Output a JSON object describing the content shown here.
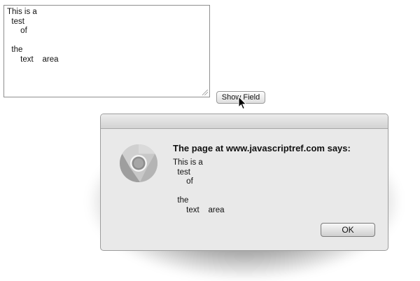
{
  "textarea": {
    "value": "This is a\n  test\n      of\n\n  the\n      text    area"
  },
  "show_button": {
    "label": "Show Field"
  },
  "alert": {
    "heading": "The page at www.javascriptref.com says:",
    "message": "This is a\n  test\n      of\n\n  the\n      text    area",
    "ok_label": "OK",
    "icon": "chrome-icon"
  },
  "colors": {
    "chrome_red": "#d64a3a",
    "chrome_green": "#3c9a4a",
    "chrome_yellow": "#f2c230",
    "chrome_blue": "#4a7fd4"
  }
}
